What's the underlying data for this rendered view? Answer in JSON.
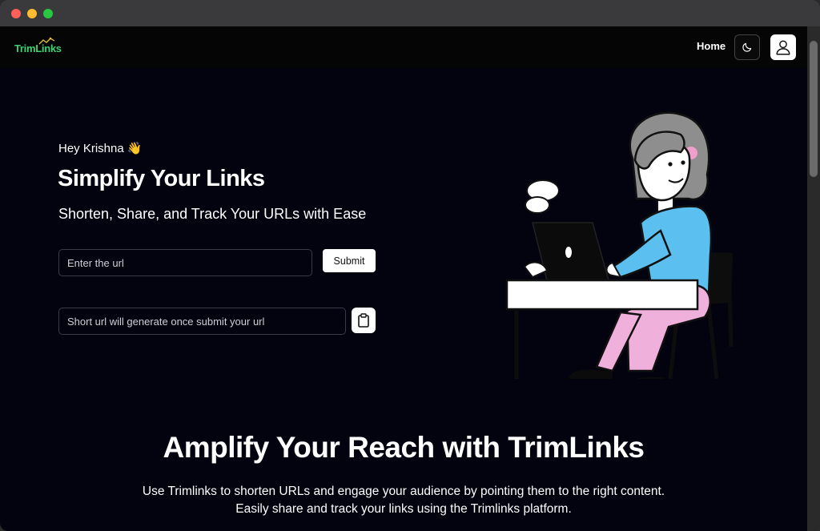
{
  "window": {
    "controls": [
      "close",
      "minimize",
      "zoom"
    ]
  },
  "navbar": {
    "logo_text": "TrimLinks",
    "home_label": "Home",
    "theme_toggle_icon": "moon-icon",
    "profile_icon": "user-icon"
  },
  "hero": {
    "greeting": "Hey Krishna 👋",
    "title": "Simplify Your Links",
    "subtitle": "Shorten, Share, and Track Your URLs with Ease",
    "url_input": {
      "placeholder": "Enter the url",
      "value": ""
    },
    "submit_label": "Submit",
    "short_url_input": {
      "placeholder": "Short url will generate once submit your url",
      "value": ""
    },
    "copy_icon": "clipboard-icon",
    "illustration": "woman-working-on-laptop-illustration"
  },
  "section": {
    "title": "Amplify Your Reach with TrimLinks",
    "desc_line1": "Use Trimlinks to shorten URLs and engage your audience by pointing them to the right content.",
    "desc_line2": "Easily share and track your links using the Trimlinks platform."
  },
  "colors": {
    "background": "#03020f",
    "navbar": "#050505",
    "logo_green": "#3ed16f",
    "shirt_blue": "#5bc0f0",
    "pants_pink": "#f0b0dc"
  }
}
